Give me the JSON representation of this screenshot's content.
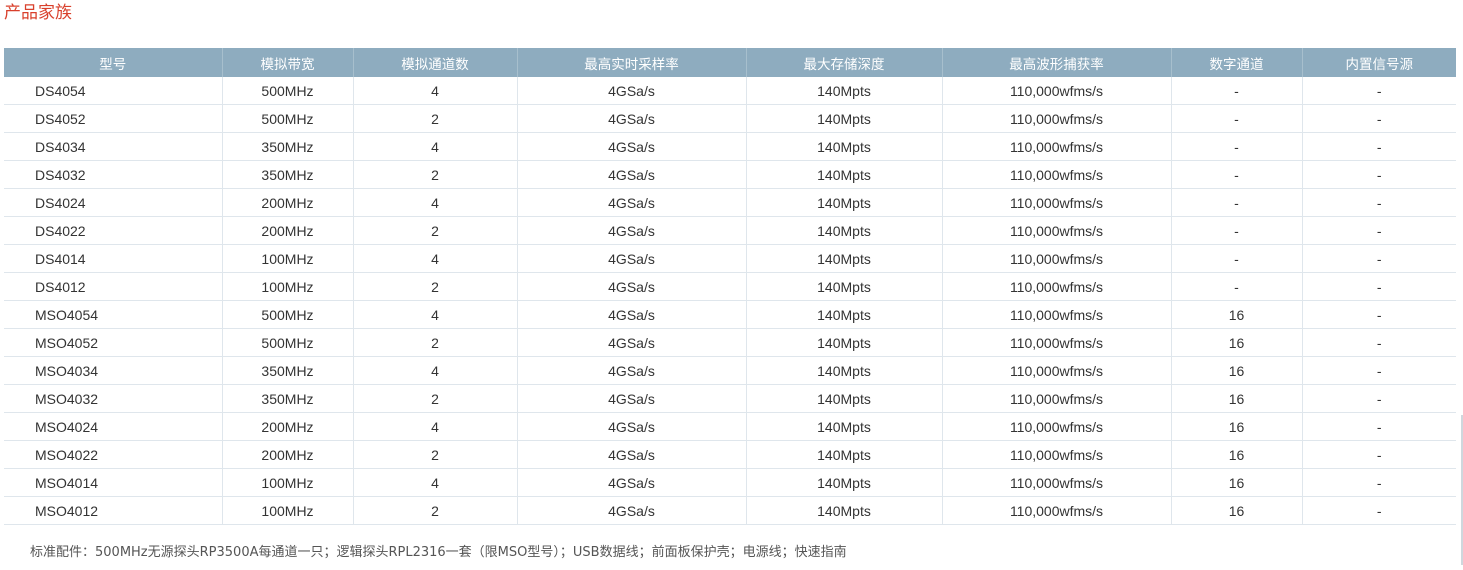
{
  "page": {
    "title": "产品家族"
  },
  "table": {
    "columns": [
      "型号",
      "模拟带宽",
      "模拟通道数",
      "最高实时采样率",
      "最大存储深度",
      "最高波形捕获率",
      "数字通道",
      "内置信号源"
    ],
    "rows": [
      [
        "DS4054",
        "500MHz",
        "4",
        "4GSa/s",
        "140Mpts",
        "110,000wfms/s",
        "-",
        "-"
      ],
      [
        "DS4052",
        "500MHz",
        "2",
        "4GSa/s",
        "140Mpts",
        "110,000wfms/s",
        "-",
        "-"
      ],
      [
        "DS4034",
        "350MHz",
        "4",
        "4GSa/s",
        "140Mpts",
        "110,000wfms/s",
        "-",
        "-"
      ],
      [
        "DS4032",
        "350MHz",
        "2",
        "4GSa/s",
        "140Mpts",
        "110,000wfms/s",
        "-",
        "-"
      ],
      [
        "DS4024",
        "200MHz",
        "4",
        "4GSa/s",
        "140Mpts",
        "110,000wfms/s",
        "-",
        "-"
      ],
      [
        "DS4022",
        "200MHz",
        "2",
        "4GSa/s",
        "140Mpts",
        "110,000wfms/s",
        "-",
        "-"
      ],
      [
        "DS4014",
        "100MHz",
        "4",
        "4GSa/s",
        "140Mpts",
        "110,000wfms/s",
        "-",
        "-"
      ],
      [
        "DS4012",
        "100MHz",
        "2",
        "4GSa/s",
        "140Mpts",
        "110,000wfms/s",
        "-",
        "-"
      ],
      [
        "MSO4054",
        "500MHz",
        "4",
        "4GSa/s",
        "140Mpts",
        "110,000wfms/s",
        "16",
        "-"
      ],
      [
        "MSO4052",
        "500MHz",
        "2",
        "4GSa/s",
        "140Mpts",
        "110,000wfms/s",
        "16",
        "-"
      ],
      [
        "MSO4034",
        "350MHz",
        "4",
        "4GSa/s",
        "140Mpts",
        "110,000wfms/s",
        "16",
        "-"
      ],
      [
        "MSO4032",
        "350MHz",
        "2",
        "4GSa/s",
        "140Mpts",
        "110,000wfms/s",
        "16",
        "-"
      ],
      [
        "MSO4024",
        "200MHz",
        "4",
        "4GSa/s",
        "140Mpts",
        "110,000wfms/s",
        "16",
        "-"
      ],
      [
        "MSO4022",
        "200MHz",
        "2",
        "4GSa/s",
        "140Mpts",
        "110,000wfms/s",
        "16",
        "-"
      ],
      [
        "MSO4014",
        "100MHz",
        "4",
        "4GSa/s",
        "140Mpts",
        "110,000wfms/s",
        "16",
        "-"
      ],
      [
        "MSO4012",
        "100MHz",
        "2",
        "4GSa/s",
        "140Mpts",
        "110,000wfms/s",
        "16",
        "-"
      ]
    ]
  },
  "footnote": "标准配件：500MHz无源探头RP3500A每通道一只；逻辑探头RPL2316一套（限MSO型号）；USB数据线；前面板保护壳；电源线；快速指南",
  "colors": {
    "title": "#d9402c",
    "header_background": "#8eacbf",
    "header_text": "#ffffff",
    "grid_line": "#dfe6ec"
  }
}
